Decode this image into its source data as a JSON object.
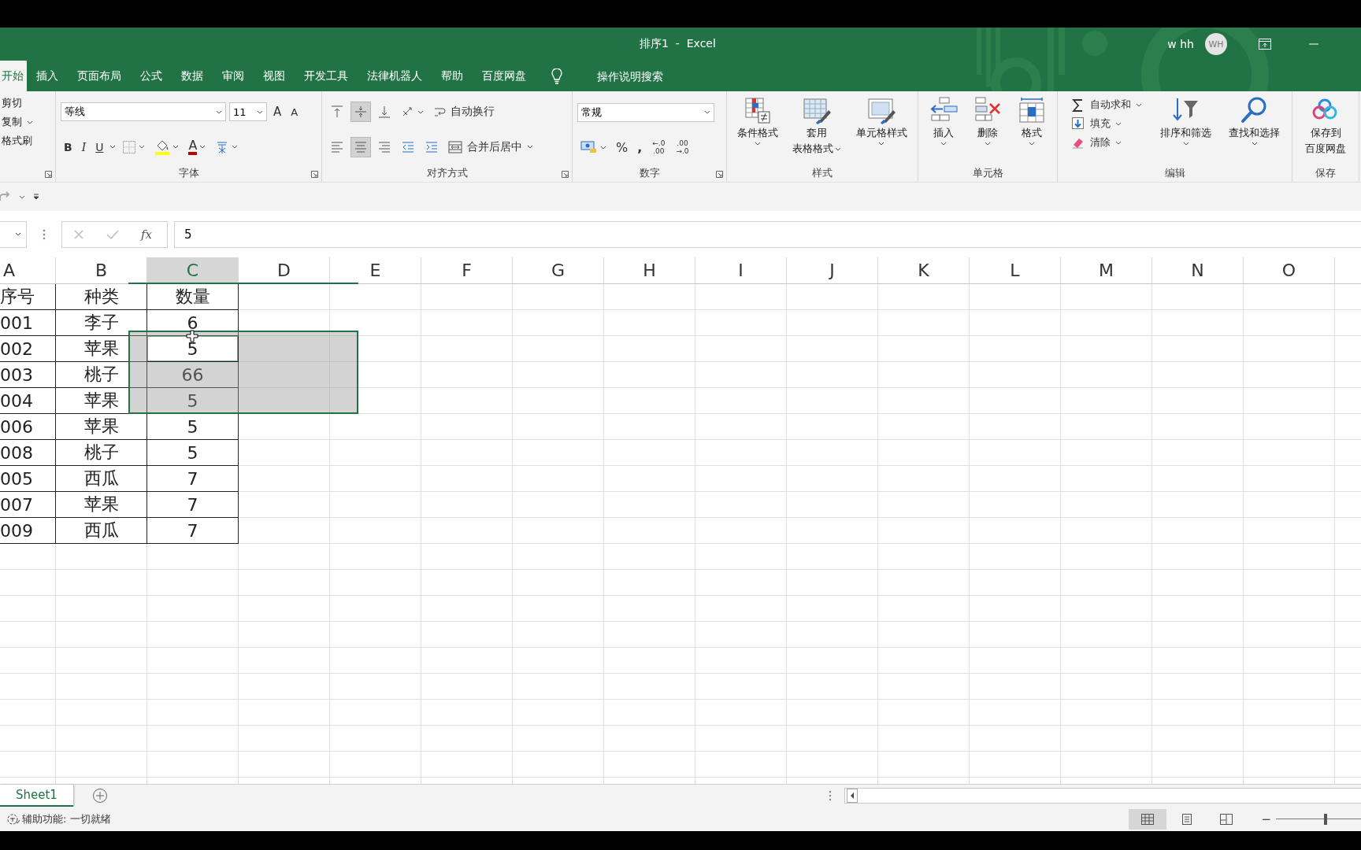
{
  "window": {
    "title": "排序1  -  Excel",
    "user": "w hh",
    "avatar": "WH"
  },
  "tabs": [
    {
      "label": "开始",
      "selected": true
    },
    {
      "label": "插入",
      "selected": false
    },
    {
      "label": "页面布局",
      "selected": false
    },
    {
      "label": "公式",
      "selected": false
    },
    {
      "label": "数据",
      "selected": false
    },
    {
      "label": "审阅",
      "selected": false
    },
    {
      "label": "视图",
      "selected": false
    },
    {
      "label": "开发工具",
      "selected": false
    },
    {
      "label": "法律机器人",
      "selected": false
    },
    {
      "label": "帮助",
      "selected": false
    },
    {
      "label": "百度网盘",
      "selected": false
    }
  ],
  "tell_me": {
    "placeholder": "操作说明搜索"
  },
  "ribbon": {
    "groups": [
      {
        "kind": "clipboard",
        "items": [
          {
            "label": "剪切",
            "dropdown": false
          },
          {
            "label": "复制",
            "dropdown": true
          },
          {
            "label": "格式刷",
            "dropdown": false
          }
        ]
      },
      {
        "kind": "font",
        "label": "字体",
        "font_name": "等线",
        "font_size": "11",
        "grow": "A",
        "shrink": "A",
        "styles": [
          "B",
          "I",
          "U"
        ],
        "font_color": "A"
      },
      {
        "kind": "alignment",
        "label": "对齐方式",
        "vertical": [
          {
            "selected": false
          },
          {
            "selected": true
          },
          {
            "selected": false
          }
        ],
        "horizontal": [
          {
            "selected": false
          },
          {
            "selected": true
          },
          {
            "selected": false
          }
        ],
        "wrap": "自动换行",
        "merge": "合并后居中"
      },
      {
        "kind": "number",
        "label": "数字",
        "format": "常规",
        "percent": "%",
        "comma": ",",
        "increase_decimal": [
          "←.0",
          ".00"
        ],
        "decrease_decimal": [
          ".00",
          "→.0"
        ]
      },
      {
        "kind": "large",
        "label": "样式",
        "buttons": [
          {
            "kind": "conditional",
            "lines": [
              "条件格式"
            ]
          },
          {
            "kind": "table",
            "lines": [
              "套用",
              "表格格式"
            ]
          },
          {
            "kind": "cellstyle",
            "lines": [
              "单元格样式"
            ]
          }
        ]
      },
      {
        "kind": "large",
        "label": "单元格",
        "buttons": [
          {
            "kind": "insert",
            "lines": [
              "插入"
            ]
          },
          {
            "kind": "delete",
            "lines": [
              "删除"
            ]
          },
          {
            "kind": "format",
            "lines": [
              "格式"
            ]
          }
        ]
      },
      {
        "kind": "editing",
        "label": "编辑",
        "small": [
          {
            "kind": "sum",
            "label": "自动求和"
          },
          {
            "kind": "fill",
            "label": "填充"
          },
          {
            "kind": "eraser",
            "label": "清除"
          }
        ],
        "buttons": [
          {
            "kind": "sort",
            "lines": [
              "排序和筛选"
            ]
          },
          {
            "kind": "find",
            "lines": [
              "查找和选择"
            ]
          }
        ]
      },
      {
        "kind": "large",
        "label": "保存",
        "buttons": [
          {
            "kind": "cloud",
            "lines": [
              "保存到",
              "百度网盘"
            ]
          }
        ]
      }
    ]
  },
  "formula_bar": {
    "fx": "fx",
    "value": "5"
  },
  "grid": {
    "columns": [
      {
        "label": "A",
        "selected": false
      },
      {
        "label": "B",
        "selected": false
      },
      {
        "label": "C",
        "selected": true
      },
      {
        "label": "D",
        "selected": false
      },
      {
        "label": "E",
        "selected": false
      },
      {
        "label": "F",
        "selected": false
      },
      {
        "label": "G",
        "selected": false
      },
      {
        "label": "H",
        "selected": false
      },
      {
        "label": "I",
        "selected": false
      },
      {
        "label": "J",
        "selected": false
      },
      {
        "label": "K",
        "selected": false
      },
      {
        "label": "L",
        "selected": false
      },
      {
        "label": "M",
        "selected": false
      },
      {
        "label": "N",
        "selected": false
      },
      {
        "label": "O",
        "selected": false
      }
    ],
    "rows": [
      {
        "cells": [
          "序号",
          "种类",
          "数量"
        ],
        "active": false,
        "in_selection": false
      },
      {
        "cells": [
          "001",
          "李子",
          "6"
        ],
        "active": false,
        "in_selection": false
      },
      {
        "cells": [
          "002",
          "苹果",
          "5"
        ],
        "active": true,
        "in_selection": true
      },
      {
        "cells": [
          "003",
          "桃子",
          "66"
        ],
        "active": false,
        "in_selection": true
      },
      {
        "cells": [
          "004",
          "苹果",
          "5"
        ],
        "active": false,
        "in_selection": true
      },
      {
        "cells": [
          "006",
          "苹果",
          "5"
        ],
        "active": false,
        "in_selection": false
      },
      {
        "cells": [
          "008",
          "桃子",
          "5"
        ],
        "active": false,
        "in_selection": false
      },
      {
        "cells": [
          "005",
          "西瓜",
          "7"
        ],
        "active": false,
        "in_selection": false
      },
      {
        "cells": [
          "007",
          "苹果",
          "7"
        ],
        "active": false,
        "in_selection": false
      },
      {
        "cells": [
          "009",
          "西瓜",
          "7"
        ],
        "active": false,
        "in_selection": false
      }
    ]
  },
  "sheets": [
    {
      "label": "Sheet1",
      "selected": true
    }
  ],
  "status_bar": {
    "text": "辅助功能: 一切就绪",
    "views": [
      {
        "kind": "normal",
        "selected": true
      },
      {
        "kind": "page_layout",
        "selected": false
      },
      {
        "kind": "page_break",
        "selected": false
      }
    ],
    "zoom_out": "−",
    "zoom": {
      "level": 0.42
    }
  }
}
